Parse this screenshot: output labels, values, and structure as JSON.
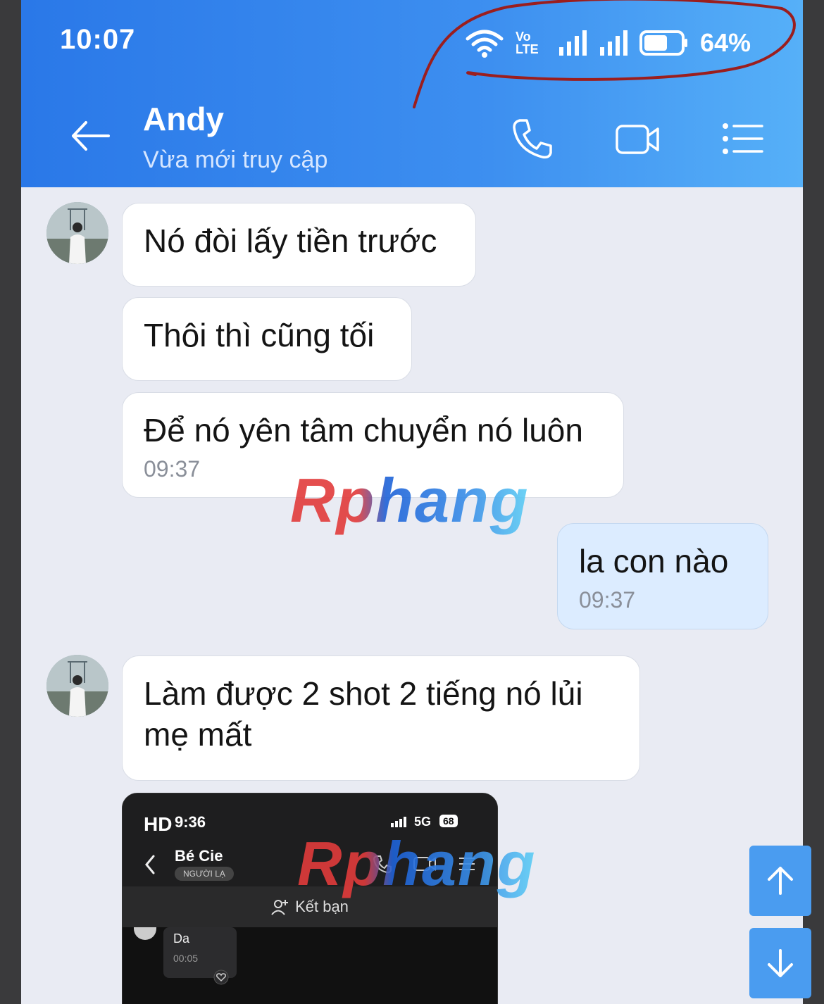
{
  "status_bar": {
    "time": "10:07",
    "network_label": "Vo LTE",
    "battery_percent": "64%",
    "battery_level": 0.64
  },
  "header": {
    "contact_name": "Andy",
    "contact_status": "Vừa mới truy cập",
    "icons": [
      "back-arrow-icon",
      "phone-icon",
      "video-call-icon",
      "menu-list-icon"
    ]
  },
  "messages": [
    {
      "from": "other",
      "text": "Nó đòi lấy tiền trước"
    },
    {
      "from": "other",
      "text": "Thôi thì cũng tối"
    },
    {
      "from": "other",
      "text": "Để nó yên tâm chuyển nó luôn",
      "time": "09:37"
    },
    {
      "from": "me",
      "text": "la con nào",
      "time": "09:37"
    },
    {
      "from": "other",
      "text": "Làm được 2 shot 2 tiếng nó lủi mẹ mất"
    }
  ],
  "attachment": {
    "hd_label": "HD",
    "time": "9:36",
    "network": "5G",
    "battery": "68",
    "contact_name": "Bé Cie",
    "contact_tag": "NGƯỜI LẠ",
    "add_friend_label": "Kết bạn",
    "message_text": "Da",
    "message_time": "00:05"
  },
  "watermark": "Rphang",
  "colors": {
    "header_blue": "#2a78e8",
    "my_bubble": "#dcecff",
    "chat_bg": "#e9ebf3",
    "scroll_button": "#4a9cf0"
  }
}
